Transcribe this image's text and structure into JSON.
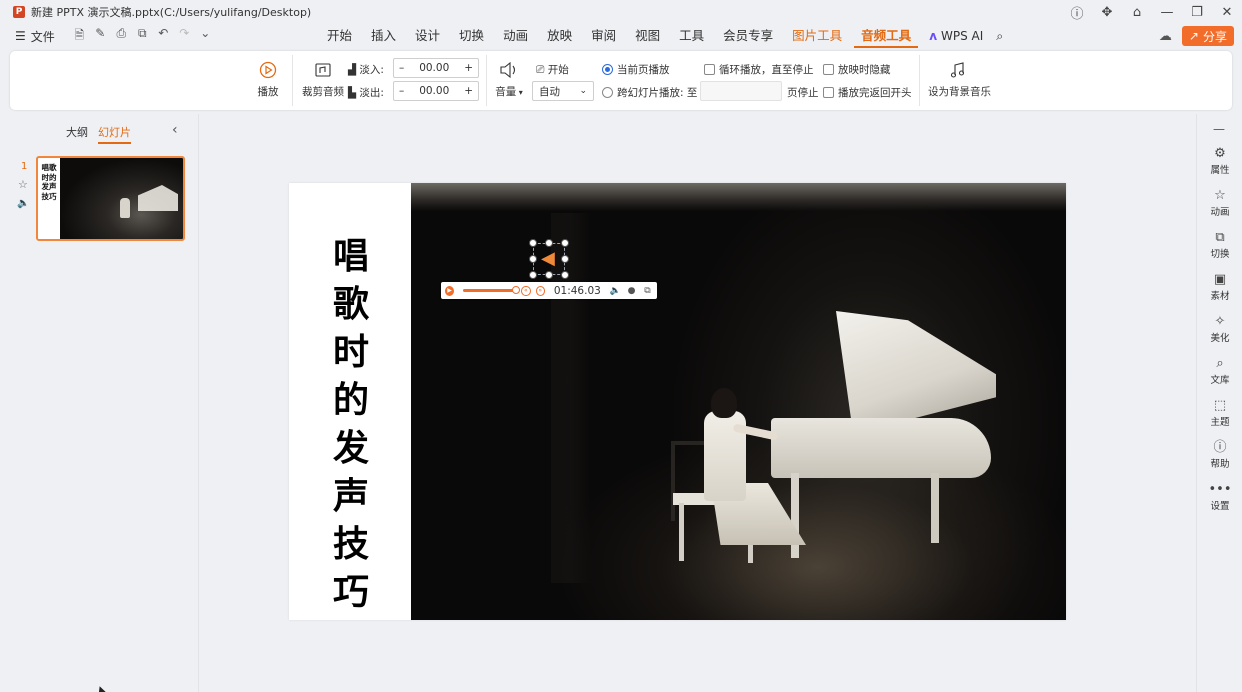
{
  "window": {
    "app_badge": "P",
    "title": "新建 PPTX 演示文稿.pptx(C:/Users/yulifang/Desktop)",
    "controls": [
      "ⓘ",
      "✥",
      "⌂",
      "—",
      "❐",
      "✕"
    ]
  },
  "menubar": {
    "file_label": "文件",
    "tabs": [
      {
        "label": "开始"
      },
      {
        "label": "插入"
      },
      {
        "label": "设计"
      },
      {
        "label": "切换"
      },
      {
        "label": "动画"
      },
      {
        "label": "放映"
      },
      {
        "label": "审阅"
      },
      {
        "label": "视图"
      },
      {
        "label": "工具"
      },
      {
        "label": "会员专享"
      },
      {
        "label": "图片工具"
      },
      {
        "label": "音频工具"
      }
    ],
    "wps_ai": "WPS AI",
    "share": "分享"
  },
  "ribbon": {
    "play": "播放",
    "trim": "裁剪音频",
    "fade_in_label": "淡入:",
    "fade_in_value": "00.00",
    "fade_out_label": "淡出:",
    "fade_out_value": "00.00",
    "volume": "音量",
    "start_label": "开始",
    "start_value": "自动",
    "play_current": "当前页播放",
    "play_across": "跨幻灯片播放: 至",
    "page_stop": "页停止",
    "loop": "循环播放，直至停止",
    "hide_during_show": "放映时隐藏",
    "rewind_after": "播放完返回开头",
    "set_bg_music": "设为背景音乐"
  },
  "left_panel": {
    "tab_outline": "大纲",
    "tab_slides": "幻灯片",
    "slide_number": "1",
    "thumb_title": "唱歌时的发声技巧"
  },
  "slide": {
    "title": "唱歌时的发声技巧",
    "audio_time": "01:46.03",
    "audio_progress": 0.95
  },
  "right_sidebar": [
    {
      "label": "属性",
      "icon": "properties-icon"
    },
    {
      "label": "动画",
      "icon": "star-icon"
    },
    {
      "label": "切换",
      "icon": "transition-icon"
    },
    {
      "label": "素材",
      "icon": "material-icon"
    },
    {
      "label": "美化",
      "icon": "beautify-icon"
    },
    {
      "label": "文库",
      "icon": "library-icon"
    },
    {
      "label": "主题",
      "icon": "theme-icon"
    },
    {
      "label": "帮助",
      "icon": "help-icon"
    },
    {
      "label": "设置",
      "icon": "more-icon"
    }
  ],
  "colors": {
    "accent": "#e36a12",
    "share_bg": "#f26c2a",
    "thumb_border": "#f0873c"
  }
}
